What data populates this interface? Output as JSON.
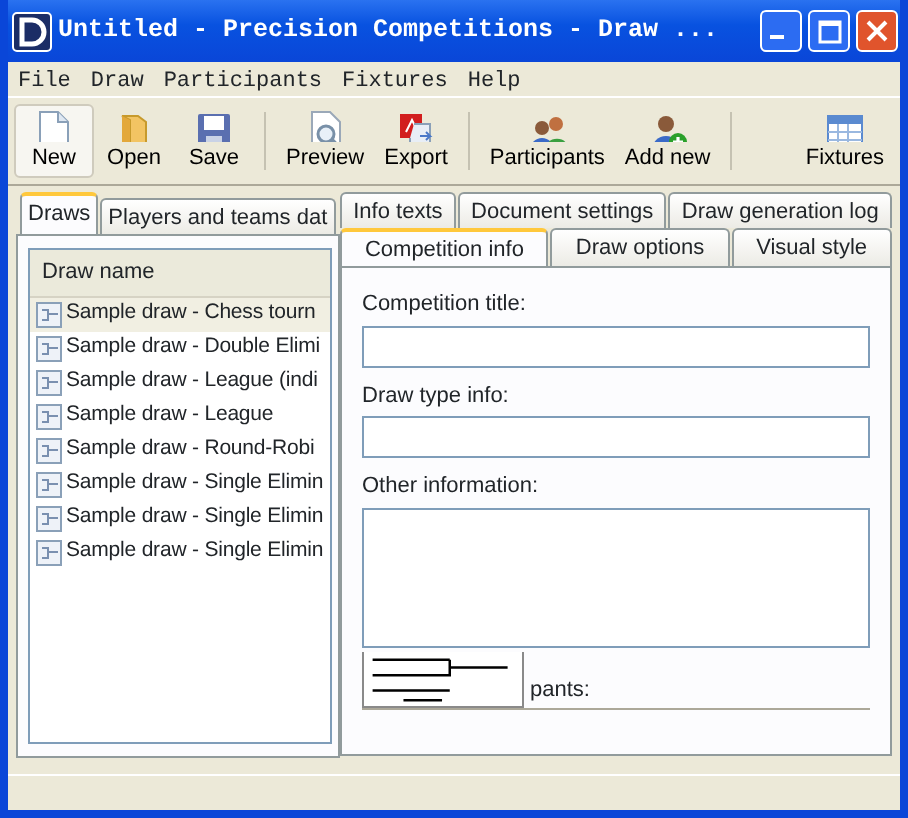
{
  "window": {
    "title": "Untitled - Precision Competitions - Draw ..."
  },
  "menu": [
    "File",
    "Draw",
    "Participants",
    "Fixtures",
    "Help"
  ],
  "toolbar": [
    {
      "label": "New",
      "selected": true
    },
    {
      "label": "Open",
      "selected": false
    },
    {
      "label": "Save",
      "selected": false
    },
    {
      "label": "Preview",
      "selected": false
    },
    {
      "label": "Export",
      "selected": false
    },
    {
      "label": "Participants",
      "selected": false
    },
    {
      "label": "Add new",
      "selected": false
    },
    {
      "label": "Fixtures",
      "selected": false
    }
  ],
  "tabs": [
    {
      "label": "Draws",
      "selected": true
    },
    {
      "label": "Players and teams dat",
      "selected": false
    }
  ],
  "draws": {
    "column": "Draw name",
    "rows": [
      {
        "name": "Sample draw - Chess tourn",
        "selected": true
      },
      {
        "name": "Sample draw - Double Elimi",
        "selected": false
      },
      {
        "name": "Sample draw - League (indi",
        "selected": false
      },
      {
        "name": "Sample draw - League",
        "selected": false
      },
      {
        "name": "Sample draw - Round-Robi",
        "selected": false
      },
      {
        "name": "Sample draw - Single Elimin",
        "selected": false
      },
      {
        "name": "Sample draw - Single Elimin",
        "selected": false
      },
      {
        "name": "Sample draw - Single Elimin",
        "selected": false
      }
    ]
  },
  "settings_panel": {
    "tabs_back": [
      {
        "label": "Info texts",
        "selected": false
      },
      {
        "label": "Document settings",
        "selected": false
      },
      {
        "label": "Draw generation log",
        "selected": false
      }
    ],
    "tabs_front": [
      {
        "label": "Competition info",
        "selected": true
      },
      {
        "label": "Draw options",
        "selected": false
      },
      {
        "label": "Visual style",
        "selected": false
      }
    ],
    "fields": [
      {
        "label": "Competition title:",
        "kind": "line"
      },
      {
        "label": "Draw type info:",
        "kind": "line"
      },
      {
        "label": "Other information:",
        "kind": "area"
      }
    ],
    "partial_label": "pants:"
  }
}
